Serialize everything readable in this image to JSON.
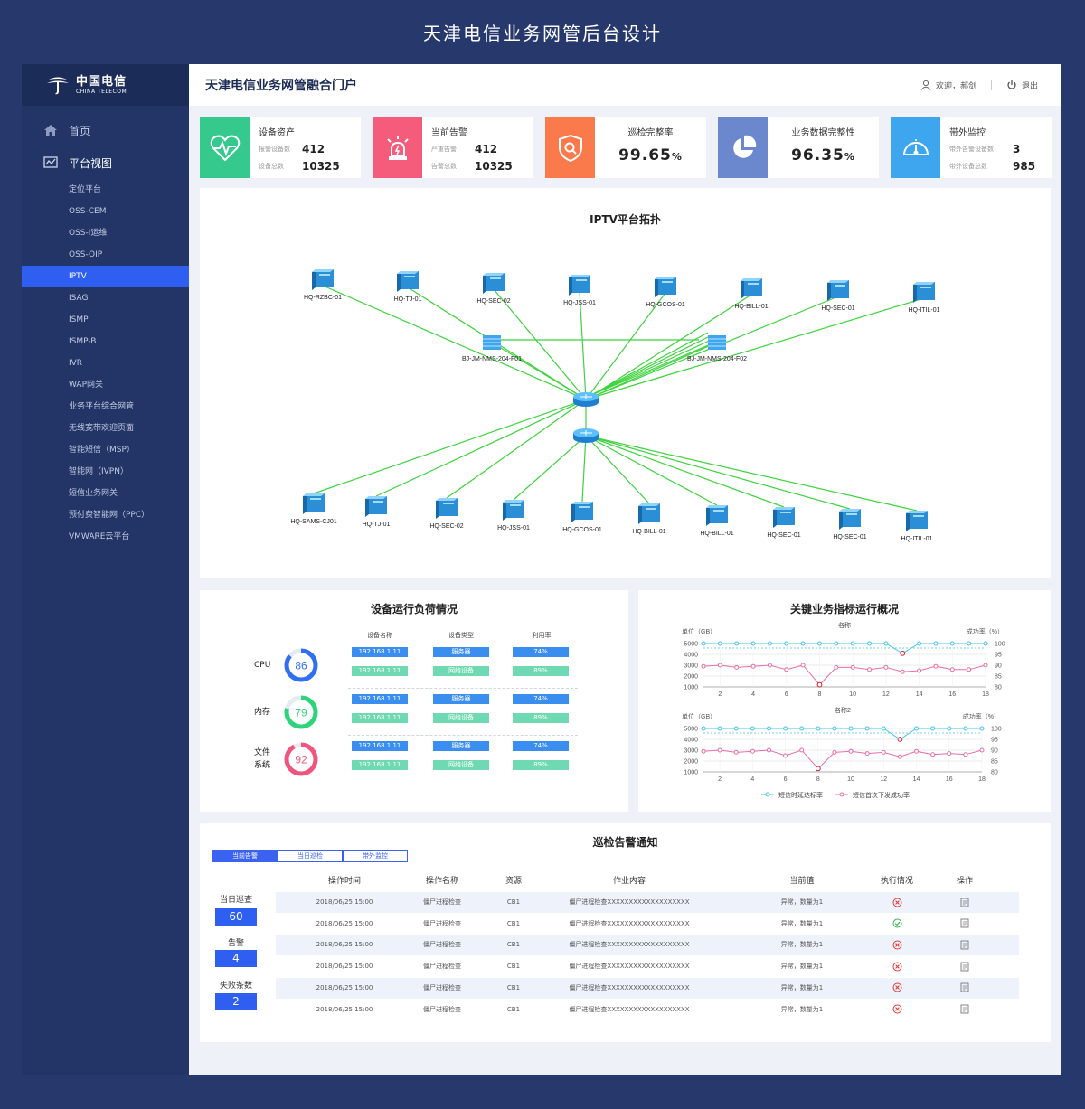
{
  "banner_title": "天津电信业务网管后台设计",
  "logo": {
    "cn": "中国电信",
    "en": "CHINA TELECOM"
  },
  "sidebar": {
    "home": "首页",
    "group": "平台视图",
    "items": [
      "定位平台",
      "OSS-CEM",
      "OSS-I运维",
      "OSS-OIP",
      "IPTV",
      "ISAG",
      "ISMP",
      "ISMP-B",
      "IVR",
      "WAP网关",
      "业务平台综合网管",
      "无线宽带欢迎页面",
      "智能短信（MSP）",
      "智能网（IVPN）",
      "短信业务网关",
      "预付费智能网（PPC）",
      "VMWARE云平台"
    ],
    "active_index": 4
  },
  "header": {
    "title": "天津电信业务网管融合门户",
    "user": "欢迎，郝剑",
    "logout": "退出"
  },
  "kpis": [
    {
      "title": "设备资产",
      "icon": "heart-pulse-icon",
      "color": "#35c98e",
      "rows": [
        {
          "label": "报警设备数",
          "value": "412"
        },
        {
          "label": "设备总数",
          "value": "10325"
        }
      ]
    },
    {
      "title": "当前告警",
      "icon": "alarm-siren-icon",
      "color": "#f55b7a",
      "rows": [
        {
          "label": "严重告警",
          "value": "412"
        },
        {
          "label": "告警总数",
          "value": "10325"
        }
      ]
    },
    {
      "title": "巡检完整率",
      "icon": "shield-search-icon",
      "color": "#fb7a4b",
      "value": "99.65",
      "unit": "%"
    },
    {
      "title": "业务数据完整性",
      "icon": "pie-chart-icon",
      "color": "#6b88cf",
      "value": "96.35",
      "unit": "%"
    },
    {
      "title": "带外监控",
      "icon": "gauge-dial-icon",
      "color": "#3ea6ef",
      "rows": [
        {
          "label": "带外告警设备数",
          "value": "3"
        },
        {
          "label": "带外设备总数",
          "value": "985"
        }
      ]
    }
  ],
  "topology": {
    "title": "IPTV平台拓扑",
    "top_servers": [
      "HQ-RZBC-01",
      "HQ-TJ-01",
      "HQ-SEC-02",
      "HQ-JSS-01",
      "HQ-GCOS-01",
      "HQ-BILL-01",
      "HQ-SEC-01",
      "HQ-ITIL-01"
    ],
    "firewalls": [
      "BJ-JM-NMS-204-F01",
      "BJ-JM-NMS-204-F02"
    ],
    "bottom_servers": [
      "HQ-SAMS-CJ01",
      "HQ-TJ-01",
      "HQ-SEC-02",
      "HQ-JSS-01",
      "HQ-GCOS-01",
      "HQ-BILL-01",
      "HQ-BILL-01",
      "HQ-SEC-01",
      "HQ-SEC-01",
      "HQ-ITIL-01"
    ]
  },
  "load": {
    "title": "设备运行负荷情况",
    "headers": [
      "设备名称",
      "设备类型",
      "利用率"
    ],
    "items": [
      {
        "label": "CPU",
        "value": 86,
        "color": "#2f6ff0"
      },
      {
        "label": "内存",
        "value": 79,
        "color": "#2ed47a"
      },
      {
        "label": "文件\n系统",
        "value": 92,
        "color": "#f0567d"
      }
    ],
    "rows": [
      {
        "name": "192.168.1.11",
        "type": "服务器",
        "rate": "74%"
      },
      {
        "name": "192.168.1.11",
        "type": "网络设备",
        "rate": "89%"
      }
    ]
  },
  "kpi_chart": {
    "title": "关键业务指标运行概况",
    "legend": [
      "短信时延达标率",
      "短信首次下发成功率"
    ],
    "colors": [
      "#45c3ee",
      "#e56fa8"
    ],
    "charts": [
      {
        "type": "line",
        "title": "名称",
        "ylabel_left": "单位（GB）",
        "ylabel_right": "成功率（%）",
        "y_left_ticks": [
          "5000",
          "4000",
          "3000",
          "2000",
          "1000"
        ],
        "y_right_ticks": [
          "100",
          "95",
          "90",
          "85",
          "80"
        ],
        "x_ticks": [
          "2",
          "4",
          "6",
          "8",
          "10",
          "12",
          "14",
          "16",
          "18"
        ],
        "xlim": [
          1,
          18
        ],
        "ylim": [
          1000,
          5000
        ],
        "y2lim": [
          80,
          100
        ],
        "series": [
          {
            "name": "短信时延达标率",
            "x": [
              1,
              2,
              3,
              4,
              5,
              6,
              7,
              8,
              9,
              10,
              11,
              12,
              13,
              14,
              15,
              16,
              17,
              18
            ],
            "values": [
              5000,
              5000,
              5000,
              5000,
              5000,
              5000,
              5000,
              5000,
              5000,
              5000,
              5000,
              5000,
              4100,
              5000,
              5000,
              5000,
              5000,
              5000
            ]
          },
          {
            "name": "短信首次下发成功率",
            "x": [
              1,
              2,
              3,
              4,
              5,
              6,
              7,
              8,
              9,
              10,
              11,
              12,
              13,
              14,
              15,
              16,
              17,
              18
            ],
            "values": [
              2900,
              3000,
              2800,
              2900,
              3000,
              2600,
              3000,
              1200,
              2800,
              2800,
              2600,
              2800,
              2400,
              2500,
              2900,
              2600,
              2600,
              3000
            ]
          }
        ]
      },
      {
        "type": "line",
        "title": "名称2",
        "ylabel_left": "单位（GB）",
        "ylabel_right": "成功率（%）",
        "y_left_ticks": [
          "5000",
          "4000",
          "3000",
          "2000",
          "1000"
        ],
        "y_right_ticks": [
          "100",
          "95",
          "90",
          "85",
          "80"
        ],
        "x_ticks": [
          "2",
          "4",
          "6",
          "8",
          "10",
          "12",
          "14",
          "16",
          "18"
        ],
        "xlim": [
          1,
          18
        ],
        "ylim": [
          1000,
          5000
        ],
        "y2lim": [
          80,
          100
        ],
        "series": [
          {
            "name": "短信时延达标率",
            "x": [
              1,
              2,
              3,
              4,
              5,
              6,
              7,
              8,
              9,
              10,
              11,
              12,
              13,
              14,
              15,
              16,
              17,
              18
            ],
            "values": [
              5000,
              5000,
              5000,
              5000,
              5000,
              5000,
              5000,
              5000,
              5000,
              5000,
              5000,
              5000,
              4000,
              5000,
              5000,
              5000,
              5000,
              5000
            ]
          },
          {
            "name": "短信首次下发成功率",
            "x": [
              1,
              2,
              3,
              4,
              5,
              6,
              7,
              8,
              9,
              10,
              11,
              12,
              13,
              14,
              15,
              16,
              17,
              18
            ],
            "values": [
              2900,
              3000,
              2800,
              2900,
              3000,
              2500,
              3000,
              1300,
              2800,
              2900,
              2700,
              2800,
              2400,
              2900,
              2600,
              2700,
              2600,
              3000
            ]
          }
        ]
      }
    ]
  },
  "alerts": {
    "title": "巡检告警通知",
    "tabs": [
      "当前告警",
      "当日巡检",
      "带外监控"
    ],
    "stats": [
      {
        "label": "当日巡查",
        "value": "60"
      },
      {
        "label": "告警",
        "value": "4"
      },
      {
        "label": "失败条数",
        "value": "2"
      }
    ],
    "columns": [
      "操作时间",
      "操作名称",
      "资源",
      "作业内容",
      "当前值",
      "执行情况",
      "操作"
    ],
    "rows": [
      {
        "time": "2018/06/25 15:00",
        "name": "僵尸进程检查",
        "res": "CB1",
        "content": "僵尸进程检查XXXXXXXXXXXXXXXXXXX",
        "value": "异常，数量为1",
        "status": "fail"
      },
      {
        "time": "2018/06/25 15:00",
        "name": "僵尸进程检查",
        "res": "CB1",
        "content": "僵尸进程检查XXXXXXXXXXXXXXXXXXX",
        "value": "异常，数量为1",
        "status": "ok"
      },
      {
        "time": "2018/06/25 15:00",
        "name": "僵尸进程检查",
        "res": "CB1",
        "content": "僵尸进程检查XXXXXXXXXXXXXXXXXXX",
        "value": "异常，数量为1",
        "status": "fail"
      },
      {
        "time": "2018/06/25 15:00",
        "name": "僵尸进程检查",
        "res": "CB1",
        "content": "僵尸进程检查XXXXXXXXXXXXXXXXXXX",
        "value": "异常，数量为1",
        "status": "fail"
      },
      {
        "time": "2018/06/25 15:00",
        "name": "僵尸进程检查",
        "res": "CB1",
        "content": "僵尸进程检查XXXXXXXXXXXXXXXXXXX",
        "value": "异常，数量为1",
        "status": "fail"
      },
      {
        "time": "2018/06/25 15:00",
        "name": "僵尸进程检查",
        "res": "CB1",
        "content": "僵尸进程检查XXXXXXXXXXXXXXXXXXX",
        "value": "异常，数量为1",
        "status": "fail"
      }
    ]
  }
}
